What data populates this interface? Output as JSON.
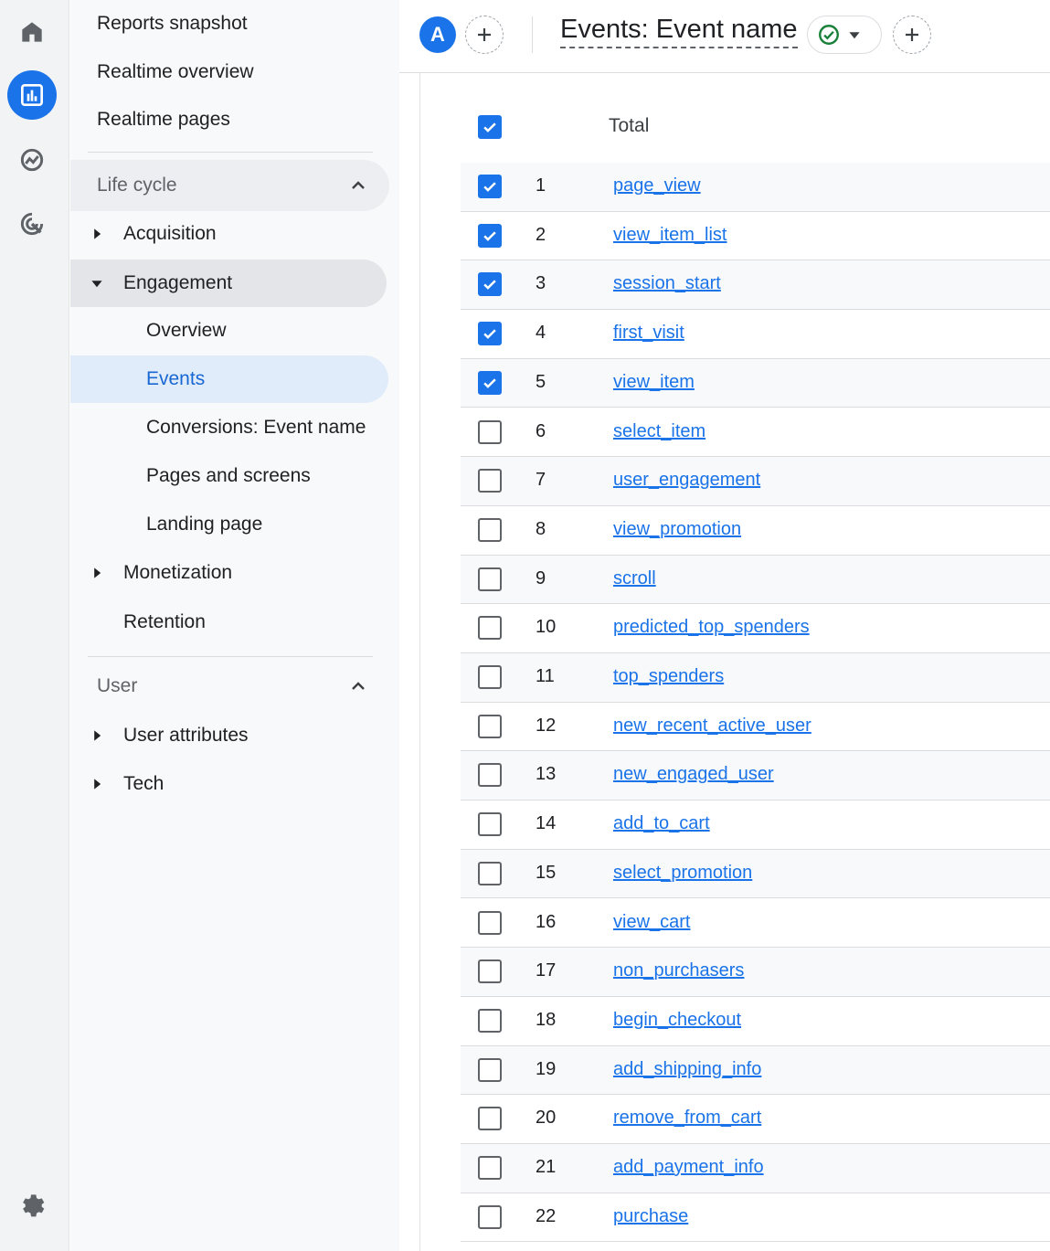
{
  "rail": {
    "icons": [
      "home-icon",
      "reports-icon",
      "explore-icon",
      "advertising-icon",
      "settings-icon"
    ],
    "active": "reports-icon"
  },
  "nav": {
    "top_items": [
      "Reports snapshot",
      "Realtime overview",
      "Realtime pages"
    ],
    "lifecycle": {
      "label": "Life cycle",
      "acquisition": "Acquisition",
      "engagement": "Engagement",
      "engagement_items": [
        "Overview",
        "Events",
        "Conversions: Event name",
        "Pages and screens",
        "Landing page"
      ],
      "monetization": "Monetization",
      "retention": "Retention"
    },
    "user": {
      "label": "User",
      "user_attributes": "User attributes",
      "tech": "Tech"
    }
  },
  "header": {
    "avatar_letter": "A",
    "title": "Events: Event name"
  },
  "table": {
    "total_label": "Total",
    "rows": [
      {
        "num": "1",
        "name": "page_view",
        "checked": true
      },
      {
        "num": "2",
        "name": "view_item_list",
        "checked": true
      },
      {
        "num": "3",
        "name": "session_start",
        "checked": true
      },
      {
        "num": "4",
        "name": "first_visit",
        "checked": true
      },
      {
        "num": "5",
        "name": "view_item",
        "checked": true
      },
      {
        "num": "6",
        "name": "select_item",
        "checked": false
      },
      {
        "num": "7",
        "name": "user_engagement",
        "checked": false
      },
      {
        "num": "8",
        "name": "view_promotion",
        "checked": false
      },
      {
        "num": "9",
        "name": "scroll",
        "checked": false
      },
      {
        "num": "10",
        "name": "predicted_top_spenders",
        "checked": false
      },
      {
        "num": "11",
        "name": "top_spenders",
        "checked": false
      },
      {
        "num": "12",
        "name": "new_recent_active_user",
        "checked": false
      },
      {
        "num": "13",
        "name": "new_engaged_user",
        "checked": false
      },
      {
        "num": "14",
        "name": "add_to_cart",
        "checked": false
      },
      {
        "num": "15",
        "name": "select_promotion",
        "checked": false
      },
      {
        "num": "16",
        "name": "view_cart",
        "checked": false
      },
      {
        "num": "17",
        "name": "non_purchasers",
        "checked": false
      },
      {
        "num": "18",
        "name": "begin_checkout",
        "checked": false
      },
      {
        "num": "19",
        "name": "add_shipping_info",
        "checked": false
      },
      {
        "num": "20",
        "name": "remove_from_cart",
        "checked": false
      },
      {
        "num": "21",
        "name": "add_payment_info",
        "checked": false
      },
      {
        "num": "22",
        "name": "purchase",
        "checked": false
      }
    ]
  },
  "colors": {
    "accent": "#1a73e8",
    "active_nav_bg": "#e1ecfb",
    "success": "#188038"
  }
}
